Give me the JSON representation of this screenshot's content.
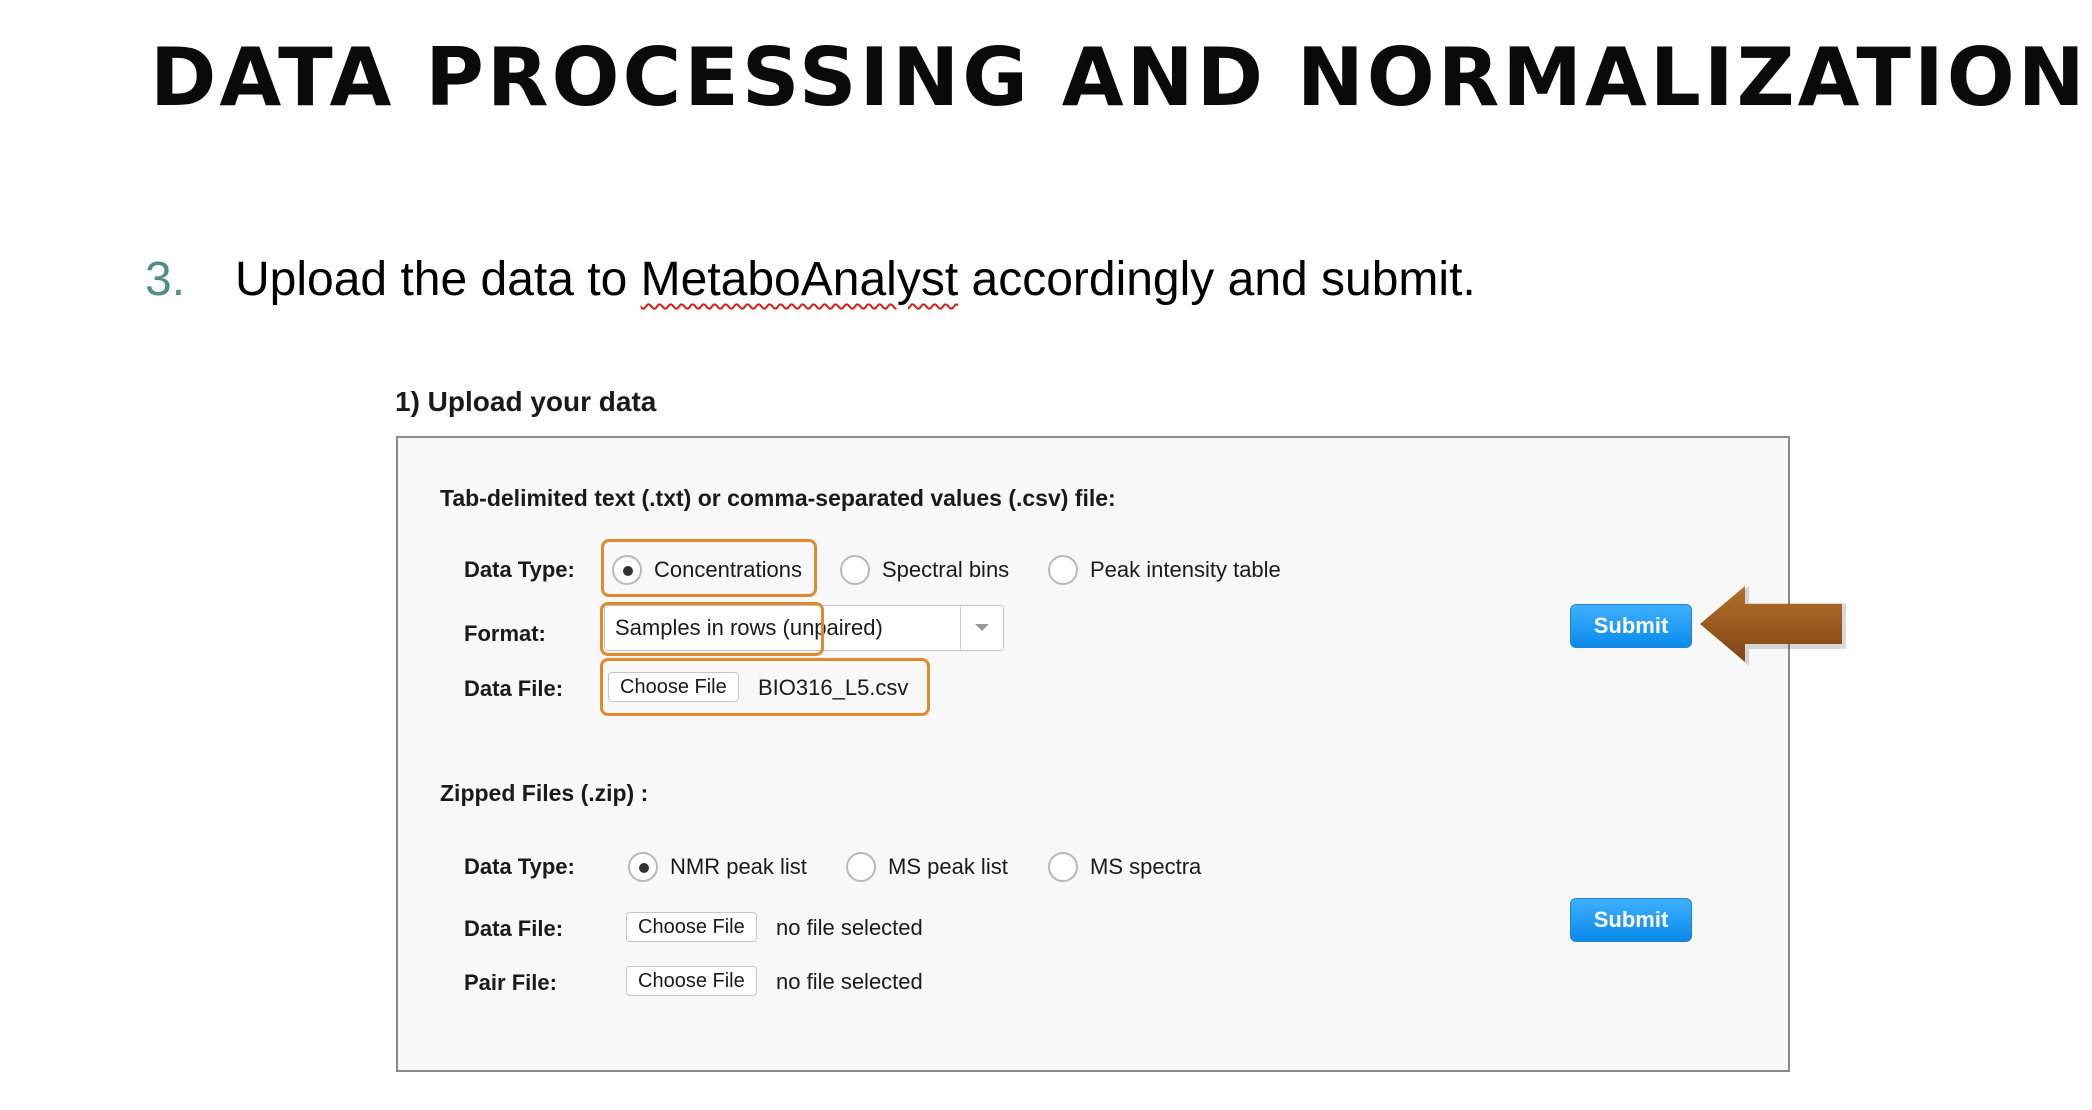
{
  "slide": {
    "title": "DATA PROCESSING AND NORMALIZATION",
    "step_number": "3.",
    "step_text_before": "Upload the data to ",
    "step_text_misspelled": "MetaboAnalyst",
    "step_text_after": " accordingly and submit."
  },
  "upload": {
    "heading": "1) Upload your data",
    "text_section": {
      "heading": "Tab-delimited text (.txt) or comma-separated values (.csv) file:",
      "data_type_label": "Data Type:",
      "data_type_options": [
        "Concentrations",
        "Spectral bins",
        "Peak intensity table"
      ],
      "data_type_selected": "Concentrations",
      "format_label": "Format:",
      "format_value": "Samples in rows (unpaired)",
      "data_file_label": "Data File:",
      "choose_file_label": "Choose File",
      "file_name": "BIO316_L5.csv",
      "submit_label": "Submit"
    },
    "zip_section": {
      "heading": "Zipped Files (.zip) :",
      "data_type_label": "Data Type:",
      "data_type_options": [
        "NMR peak list",
        "MS peak list",
        "MS spectra"
      ],
      "data_type_selected": "NMR peak list",
      "data_file_label": "Data File:",
      "data_file_button": "Choose File",
      "data_file_status": "no file selected",
      "pair_file_label": "Pair File:",
      "pair_file_button": "Choose File",
      "pair_file_status": "no file selected",
      "submit_label": "Submit"
    }
  },
  "colors": {
    "highlight": "#e08a2b",
    "submit": "#1a9af0",
    "arrow": "#9a5a1e",
    "step_number": "#4f8f8a"
  }
}
